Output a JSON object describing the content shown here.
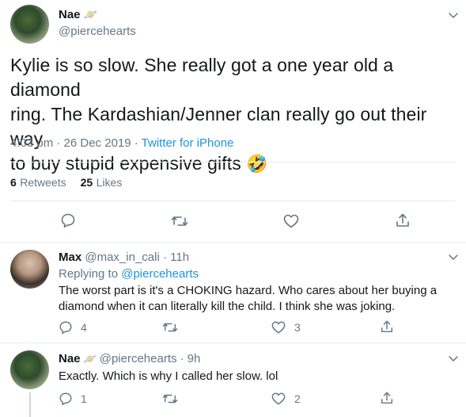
{
  "main_tweet": {
    "author_name": "Nae",
    "author_emoji": "🪐",
    "author_handle": "@piercehearts",
    "text_line1": "Kylie is so slow. She really got a one year old a diamond",
    "text_line2": "ring. The Kardashian/Jenner clan really go out their way",
    "text_line3": "to buy stupid expensive gifts",
    "text_emoji": "🤣",
    "timestamp": "4:03 pm · 26 Dec 2019 · ",
    "source": "Twitter for iPhone",
    "retweets_count": "6",
    "retweets_label": "Retweets",
    "likes_count": "25",
    "likes_label": "Likes"
  },
  "reply1": {
    "author_name": "Max",
    "author_handle": "@max_in_cali",
    "time": " · 11h",
    "replying_label": "Replying to ",
    "replying_handle": "@piercehearts",
    "text_line1": "The worst part is it's a CHOKING hazard. Who cares about her buying a",
    "text_line2": "diamond when it can literally kill the child. I think she was joking.",
    "reply_count": "4",
    "like_count": "3"
  },
  "reply2": {
    "author_name": "Nae",
    "author_emoji": "🪐",
    "author_handle": "@piercehearts",
    "time": " · 9h",
    "text": "Exactly. Which is why I called her slow. lol",
    "reply_count": "1",
    "like_count": "2"
  },
  "colors": {
    "accent": "#1b95e0",
    "secondary_text": "#657786",
    "divider": "#e6ecf0"
  },
  "icons": [
    "chevron-down-icon",
    "reply-icon",
    "retweet-icon",
    "like-icon",
    "share-icon"
  ]
}
